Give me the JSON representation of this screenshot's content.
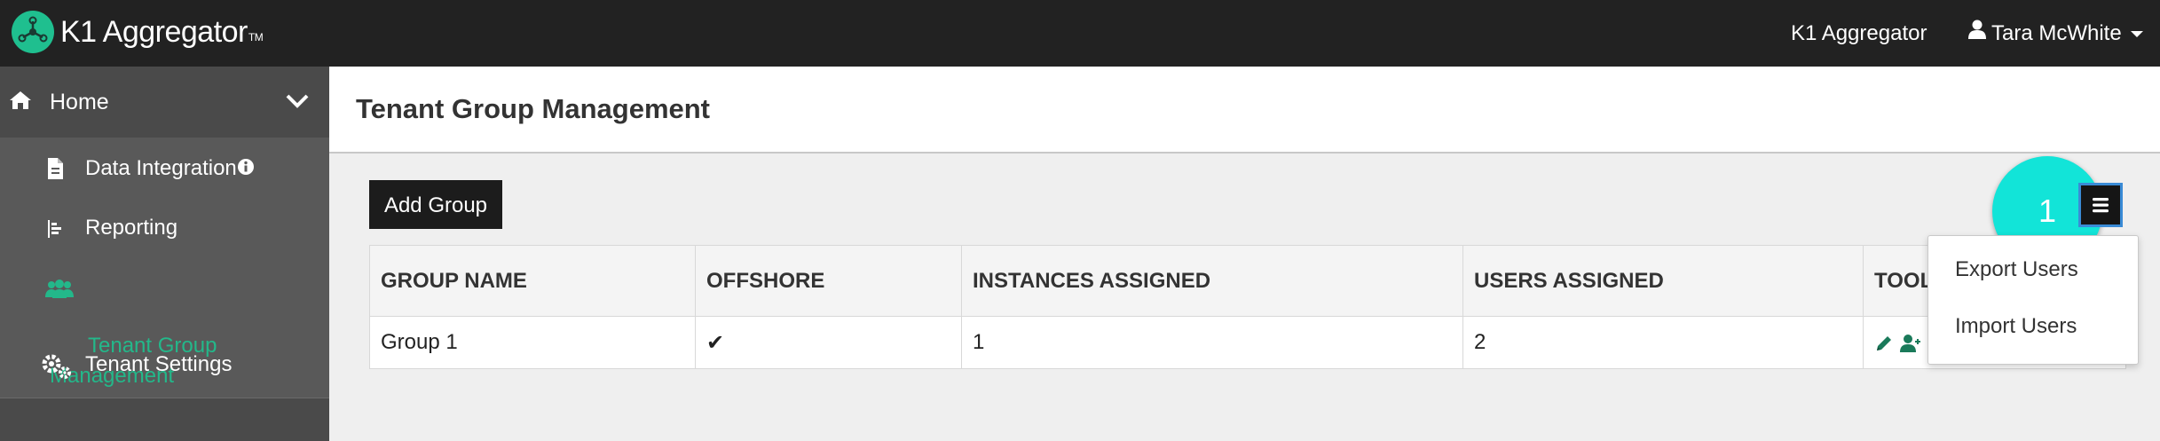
{
  "app": {
    "logo_text": "K1 Aggregator",
    "logo_tm": "TM",
    "top_link": "K1 Aggregator",
    "user_name": "Tara McWhite"
  },
  "sidebar": {
    "home_label": "Home",
    "items": [
      {
        "label": "Data Integration",
        "icon": "document-icon"
      },
      {
        "label": "Reporting",
        "icon": "bar-list-icon"
      },
      {
        "label_line1": "Tenant Group",
        "label_line2": "Management",
        "icon": "users-group-icon",
        "active": true
      },
      {
        "label": "Tenant Settings",
        "icon": "gears-icon"
      }
    ]
  },
  "page": {
    "title": "Tenant Group Management",
    "add_button": "Add Group",
    "callout_number": "1"
  },
  "table": {
    "headers": [
      "GROUP NAME",
      "OFFSHORE",
      "INSTANCES ASSIGNED",
      "USERS ASSIGNED",
      "TOOLS"
    ],
    "rows": [
      {
        "group_name": "Group 1",
        "offshore": "✔",
        "instances": "1",
        "users": "2"
      }
    ]
  },
  "dropdown": {
    "items": [
      "Export Users",
      "Import Users"
    ]
  },
  "colors": {
    "topbar": "#222222",
    "sidebar": "#595959",
    "accent_green": "#23b88a",
    "callout": "#12e4d8"
  }
}
